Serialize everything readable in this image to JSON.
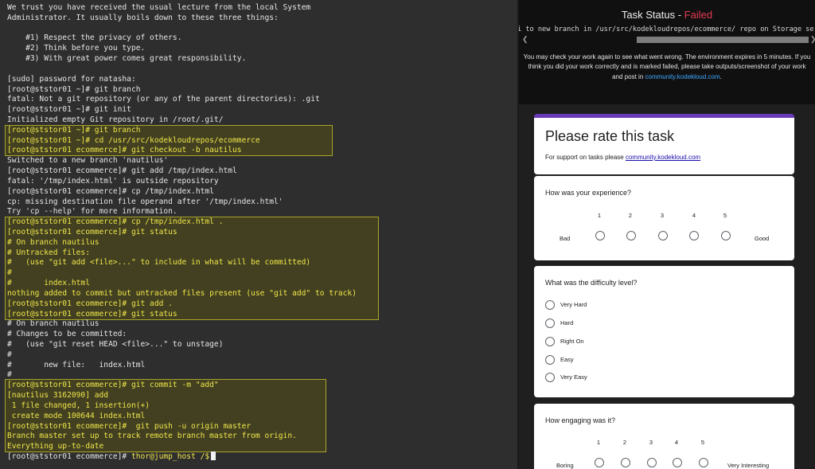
{
  "terminal": {
    "lines": [
      "We trust you have received the usual lecture from the local System",
      "Administrator. It usually boils down to these three things:",
      "",
      "    #1) Respect the privacy of others.",
      "    #2) Think before you type.",
      "    #3) With great power comes great responsibility.",
      "",
      "[sudo] password for natasha:",
      "[root@ststor01 ~]# git branch",
      "fatal: Not a git repository (or any of the parent directories): .git",
      "[root@ststor01 ~]# git init",
      "Initialized empty Git repository in /root/.git/",
      "[root@ststor01 ~]# git branch",
      "[root@ststor01 ~]# cd /usr/src/kodekloudrepos/ecommerce",
      "[root@ststor01 ecommerce]# git checkout -b nautilus",
      "Switched to a new branch 'nautilus'",
      "[root@ststor01 ecommerce]# git add /tmp/index.html",
      "fatal: '/tmp/index.html' is outside repository",
      "[root@ststor01 ecommerce]# cp /tmp/index.html",
      "cp: missing destination file operand after '/tmp/index.html'",
      "Try 'cp --help' for more information.",
      "[root@ststor01 ecommerce]# cp /tmp/index.html .",
      "[root@ststor01 ecommerce]# git status",
      "# On branch nautilus",
      "# Untracked files:",
      "#   (use \"git add <file>...\" to include in what will be committed)",
      "#",
      "#       index.html",
      "nothing added to commit but untracked files present (use \"git add\" to track)",
      "[root@ststor01 ecommerce]# git add .",
      "[root@ststor01 ecommerce]# git status",
      "# On branch nautilus",
      "# Changes to be committed:",
      "#   (use \"git reset HEAD <file>...\" to unstage)",
      "#",
      "#       new file:   index.html",
      "#",
      "[root@ststor01 ecommerce]# git commit -m \"add\"",
      "[nautilus 3162090] add",
      " 1 file changed, 1 insertion(+)",
      " create mode 100644 index.html",
      "[root@ststor01 ecommerce]#  git push -u origin master",
      "Branch master set up to track remote branch master from origin.",
      "Everything up-to-date"
    ],
    "final_prompt": "[root@ststor01 ecommerce]# ",
    "final_host": "thor@jump_host /$"
  },
  "task_status": {
    "title": "Task Status - ",
    "result": "Failed",
    "task_line": "i to new branch in /usr/src/kodekloudrepos/ecommerce/ repo on Storage serve",
    "message_1": "You may check your work again to see what went wrong. The environment expires in 5 minutes. If you",
    "message_2": "think you did your work correctly and is marked failed, please take outputs/screenshot of your work",
    "message_3": "and post in ",
    "message_link": "community.kodekloud.com",
    "message_end": "."
  },
  "survey": {
    "title": "Please rate this task",
    "support_text": "For support on tasks please ",
    "support_link": "community.kodekloud.com",
    "q1": {
      "title": "How was your experience?",
      "scale": [
        "1",
        "2",
        "3",
        "4",
        "5"
      ],
      "low": "Bad",
      "high": "Good"
    },
    "q2": {
      "title": "What was the difficulty level?",
      "options": [
        "Very Hard",
        "Hard",
        "Right On",
        "Easy",
        "Very Easy"
      ]
    },
    "q3": {
      "title": "How engaging was it?",
      "scale": [
        "1",
        "2",
        "3",
        "4",
        "5"
      ],
      "low": "Boring",
      "high": "Very Interesting"
    }
  },
  "colors": {
    "failed": "#e63b53",
    "accent": "#673ab7",
    "terminal_highlight": "#f0e64a",
    "link": "#3fa7ff"
  }
}
